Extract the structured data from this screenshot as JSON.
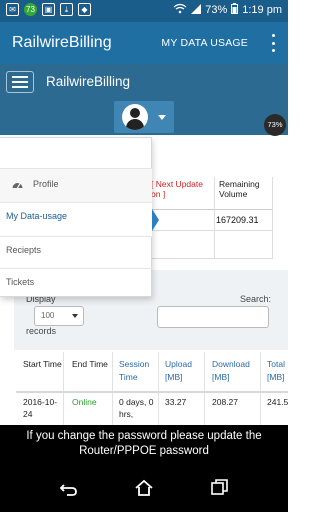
{
  "status_bar": {
    "badge_count": "73",
    "battery_percent": "73%",
    "time": "1:19 pm"
  },
  "app_bar": {
    "title": "RailwireBilling",
    "menu_item": "MY DATA USAGE"
  },
  "web_nav": {
    "brand": "RailwireBilling"
  },
  "user_menu": {
    "usage_badge": "73%",
    "items": [
      {
        "label": "Profile"
      },
      {
        "label": "My Data-usage"
      },
      {
        "label": "Reciepts"
      },
      {
        "label": "Tickets"
      }
    ]
  },
  "summary_table": {
    "headers": [
      "[ Next Update on ]",
      "Remaining Volume"
    ],
    "remaining_volume": "167209.31"
  },
  "datatable_controls": {
    "display_label": "Display",
    "page_size": "100",
    "records_label": "records",
    "search_label": "Search:",
    "search_value": ""
  },
  "usage_table": {
    "columns": [
      {
        "label": "Start Time",
        "style": "plain"
      },
      {
        "label": "End Time",
        "style": "plain"
      },
      {
        "label": "Session Time",
        "style": "link"
      },
      {
        "label": "Upload [MB]",
        "style": "link"
      },
      {
        "label": "Download [MB]",
        "style": "link"
      },
      {
        "label": "Total [MB]",
        "style": "link"
      }
    ],
    "rows": [
      {
        "start_time": "2016-10-24",
        "end_time": "Online",
        "session_time": "0 days, 0 hrs,",
        "upload": "33.27",
        "download": "208.27",
        "total": "241.5"
      }
    ]
  },
  "toast": {
    "message": "If you change the password please update the Router/PPPOE password"
  },
  "colors": {
    "status_bar": "#1a5c8a",
    "app_bar": "#1f6fa3",
    "web_nav": "#2d6a91",
    "link": "#2a6aaa",
    "online": "#2aa12a",
    "warning": "#cc2222"
  }
}
